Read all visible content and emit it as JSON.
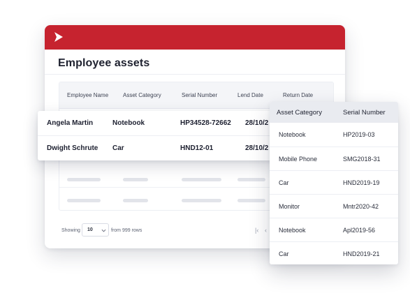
{
  "colors": {
    "brand": "#c6232f",
    "header_bg": "#f4f5f8",
    "skeleton": "#e2e4ea"
  },
  "app": {
    "logo_icon": "chevron-right-icon",
    "title": "Employee assets"
  },
  "table": {
    "columns": [
      "Employee Name",
      "Asset Category",
      "Serial Number",
      "Lend Date",
      "Return Date"
    ],
    "rows": [
      {
        "name": "Angela Martin",
        "category": "Notebook",
        "serial": "HP34528-72662",
        "lend": "28/10/2"
      },
      {
        "name": "Dwight Schrute",
        "category": "Car",
        "serial": "HND12-01",
        "lend": "28/10/2"
      }
    ]
  },
  "pagination": {
    "showing_label": "Showing",
    "rows_per_page": "10",
    "from_label": "from 999 rows",
    "first_icon": "first-page-icon",
    "prev_icon": "prev-page-icon"
  },
  "side_table": {
    "columns": [
      "Asset Category",
      "Serial Number"
    ],
    "rows": [
      {
        "category": "Notebook",
        "serial": "HP2019-03"
      },
      {
        "category": "Mobile Phone",
        "serial": "SMG2018-31"
      },
      {
        "category": "Car",
        "serial": "HND2019-19"
      },
      {
        "category": "Monitor",
        "serial": "Mntr2020-42"
      },
      {
        "category": "Notebook",
        "serial": "Apl2019-56"
      },
      {
        "category": "Car",
        "serial": "HND2019-21"
      }
    ]
  }
}
